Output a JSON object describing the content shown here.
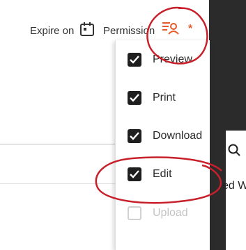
{
  "toolbar": {
    "expire_label": "Expire on",
    "permission_label": "Permission",
    "required_marker": "*",
    "accent_color": "#e65a2a"
  },
  "permissions_menu": {
    "items": [
      {
        "label": "Preview",
        "checked": true,
        "enabled": true
      },
      {
        "label": "Print",
        "checked": true,
        "enabled": true
      },
      {
        "label": "Download",
        "checked": true,
        "enabled": true
      },
      {
        "label": "Edit",
        "checked": true,
        "enabled": true
      },
      {
        "label": "Upload",
        "checked": false,
        "enabled": false
      }
    ]
  },
  "side_panel": {
    "partial_text": "ed W"
  },
  "annotation_color": "#c8202a"
}
